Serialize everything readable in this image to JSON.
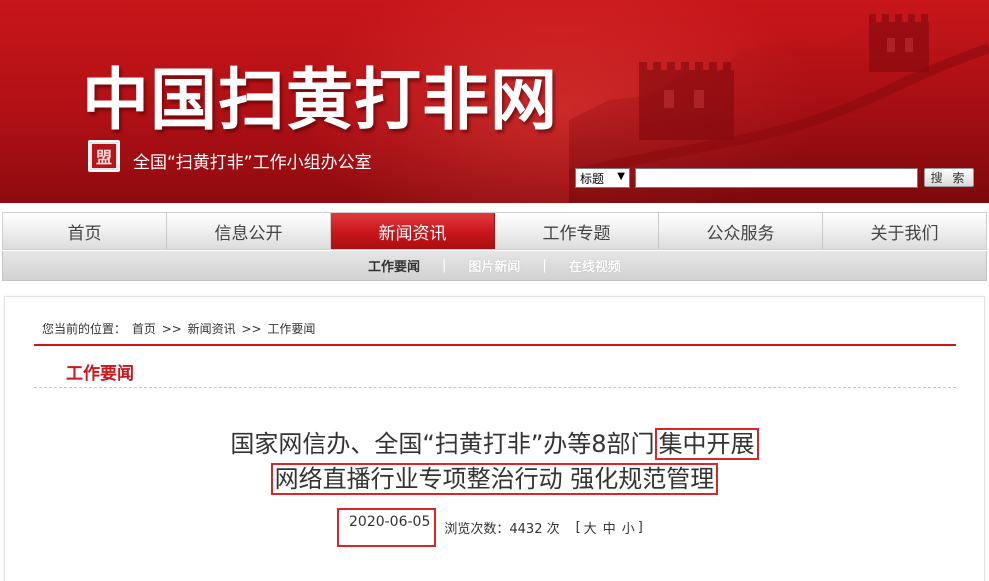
{
  "header": {
    "site_title": "中国扫黄打非网",
    "office_name": "全国“扫黄打非”工作小组办公室",
    "seal_glyph": "盟",
    "search": {
      "select_value": "标题",
      "input_value": "",
      "button_label": "搜 索"
    }
  },
  "nav": {
    "items": [
      {
        "label": "首页"
      },
      {
        "label": "信息公开"
      },
      {
        "label": "新闻资讯"
      },
      {
        "label": "工作专题"
      },
      {
        "label": "公众服务"
      },
      {
        "label": "关于我们"
      }
    ]
  },
  "subnav": {
    "items": [
      {
        "label": "工作要闻"
      },
      {
        "label": "图片新闻"
      },
      {
        "label": "在线视频"
      }
    ],
    "separator": "|"
  },
  "breadcrumb": {
    "prefix": "您当前的位置：",
    "items": [
      "首页",
      ">>",
      "新闻资讯",
      ">>",
      "工作要闻"
    ]
  },
  "section": {
    "title": "工作要闻"
  },
  "article": {
    "title_part1": "国家网信办、全国“扫黄打非”办等8部门",
    "title_part2_highlight": "集中开展",
    "title_line2_highlight": "网络直播行业专项整治行动 强化规范管理",
    "date": "2020-06-05",
    "views_label": "浏览次数：4432 次",
    "font_size": {
      "open": "[",
      "large": "大",
      "medium": "中",
      "small": "小",
      "close": "]"
    }
  },
  "colors": {
    "brand_red": "#c8161b",
    "highlight_box": "#d9262b"
  }
}
